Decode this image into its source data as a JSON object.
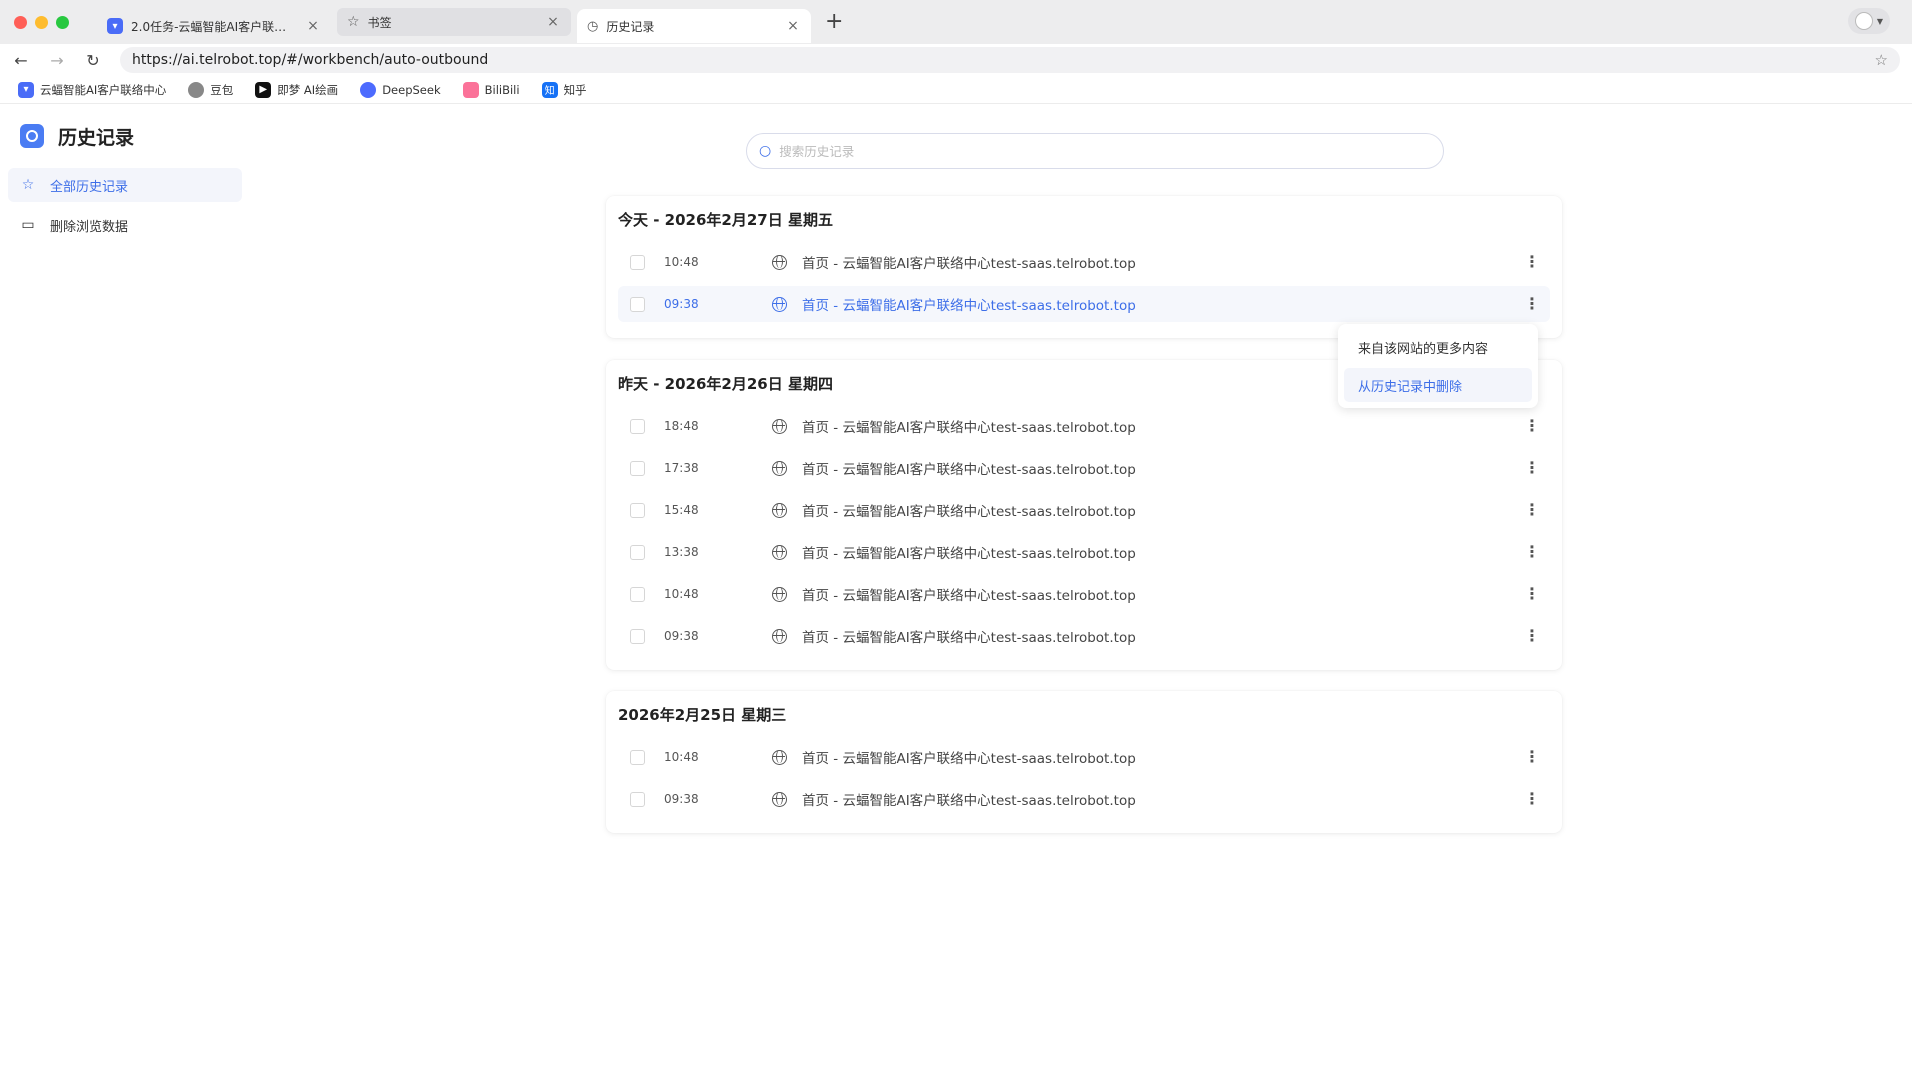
{
  "browser": {
    "tabs": [
      {
        "label": "2.0任务-云蝠智能AI客户联络…",
        "icon": "telrobot-favicon",
        "state": "inactive"
      },
      {
        "label": "书签",
        "icon": "star-icon",
        "state": "inactive"
      },
      {
        "label": "历史记录",
        "icon": "history-icon",
        "state": "active"
      }
    ],
    "new_tab": "+",
    "url": "https://ai.telrobot.top/#/workbench/auto-outbound",
    "bookmarks": [
      {
        "label": "云蝠智能AI客户联络中心",
        "color": "#4a6cf7"
      },
      {
        "label": "豆包",
        "color": "#666666"
      },
      {
        "label": "即梦 AI绘画",
        "color": "#111111"
      },
      {
        "label": "DeepSeek",
        "color": "#4d6bfe"
      },
      {
        "label": "BiliBili",
        "color": "#fb7299"
      },
      {
        "label": "知乎",
        "color": "#1772f6"
      }
    ]
  },
  "sidebar": {
    "title": "历史记录",
    "items": [
      {
        "label": "全部历史记录",
        "icon": "star-icon",
        "active": true
      },
      {
        "label": "删除浏览数据",
        "icon": "folder-icon",
        "active": false
      }
    ]
  },
  "search": {
    "placeholder": "搜索历史记录"
  },
  "groups": [
    {
      "title": "今天 - 2026年2月27日  星期五",
      "rows": [
        {
          "time": "10:48",
          "title": "首页 - 云蝠智能AI客户联络中心test-saas.telrobot.top"
        },
        {
          "time": "09:38",
          "title": "首页 - 云蝠智能AI客户联络中心test-saas.telrobot.top",
          "hover": true
        }
      ]
    },
    {
      "title": "昨天 - 2026年2月26日  星期四",
      "rows": [
        {
          "time": "18:48",
          "title": "首页 - 云蝠智能AI客户联络中心test-saas.telrobot.top"
        },
        {
          "time": "17:38",
          "title": "首页 - 云蝠智能AI客户联络中心test-saas.telrobot.top"
        },
        {
          "time": "15:48",
          "title": "首页 - 云蝠智能AI客户联络中心test-saas.telrobot.top"
        },
        {
          "time": "13:38",
          "title": "首页 - 云蝠智能AI客户联络中心test-saas.telrobot.top"
        },
        {
          "time": "10:48",
          "title": "首页 - 云蝠智能AI客户联络中心test-saas.telrobot.top"
        },
        {
          "time": "09:38",
          "title": "首页 - 云蝠智能AI客户联络中心test-saas.telrobot.top"
        }
      ]
    },
    {
      "title": "2026年2月25日  星期三",
      "rows": [
        {
          "time": "10:48",
          "title": "首页 - 云蝠智能AI客户联络中心test-saas.telrobot.top"
        },
        {
          "time": "09:38",
          "title": "首页 - 云蝠智能AI客户联络中心test-saas.telrobot.top"
        }
      ]
    }
  ],
  "context_menu": {
    "items": [
      {
        "label": "来自该网站的更多内容",
        "active": false
      },
      {
        "label": "从历史记录中删除",
        "active": true
      }
    ]
  },
  "colors": {
    "accent": "#3d6ee8",
    "hover_bg": "#f3f5fb"
  }
}
